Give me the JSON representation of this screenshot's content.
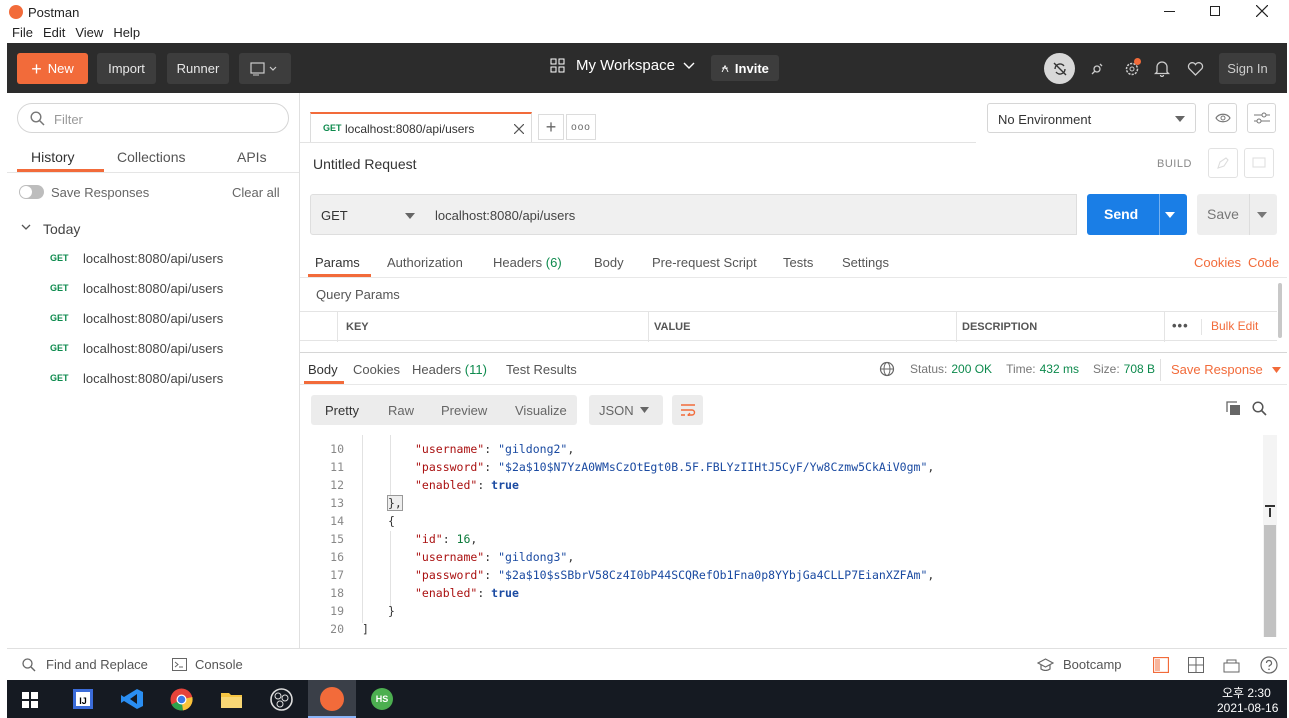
{
  "window": {
    "title": "Postman"
  },
  "menu": [
    "File",
    "Edit",
    "View",
    "Help"
  ],
  "header": {
    "new_label": "New",
    "import_label": "Import",
    "runner_label": "Runner",
    "workspace_label": "My Workspace",
    "invite_label": "Invite",
    "signin_label": "Sign In"
  },
  "sidebar": {
    "filter_placeholder": "Filter",
    "tabs": [
      "History",
      "Collections",
      "APIs"
    ],
    "save_responses_label": "Save Responses",
    "clear_all_label": "Clear all",
    "group_label": "Today",
    "items": [
      {
        "method": "GET",
        "url": "localhost:8080/api/users"
      },
      {
        "method": "GET",
        "url": "localhost:8080/api/users"
      },
      {
        "method": "GET",
        "url": "localhost:8080/api/users"
      },
      {
        "method": "GET",
        "url": "localhost:8080/api/users"
      },
      {
        "method": "GET",
        "url": "localhost:8080/api/users"
      }
    ]
  },
  "request_tab": {
    "method": "GET",
    "url": "localhost:8080/api/users"
  },
  "environment": {
    "selected": "No Environment"
  },
  "request": {
    "title": "Untitled Request",
    "build_label": "BUILD",
    "method": "GET",
    "url": "localhost:8080/api/users",
    "send_label": "Send",
    "save_label": "Save",
    "tabs": {
      "params": "Params",
      "authorization": "Authorization",
      "headers": "Headers",
      "headers_count": "(6)",
      "body": "Body",
      "prerequest": "Pre-request Script",
      "tests": "Tests",
      "settings": "Settings"
    },
    "cookies_label": "Cookies",
    "code_label": "Code",
    "query_params_label": "Query Params",
    "table_headers": {
      "key": "KEY",
      "value": "VALUE",
      "description": "DESCRIPTION"
    },
    "bulk_edit_label": "Bulk Edit"
  },
  "response": {
    "tabs": {
      "body": "Body",
      "cookies": "Cookies",
      "headers": "Headers",
      "headers_count": "(11)",
      "test_results": "Test Results"
    },
    "status_label": "Status:",
    "status_value": "200 OK",
    "time_label": "Time:",
    "time_value": "432 ms",
    "size_label": "Size:",
    "size_value": "708 B",
    "save_response_label": "Save Response",
    "view_modes": [
      "Pretty",
      "Raw",
      "Preview",
      "Visualize"
    ],
    "format": "JSON",
    "lines": [
      {
        "n": "10",
        "key": "\"username\"",
        "val": "\"gildong2\"",
        "type": "s",
        "trail": ","
      },
      {
        "n": "11",
        "key": "\"password\"",
        "val": "\"$2a$10$N7YzA0WMsCzOtEgt0B.5F.FBLYzIIHtJ5CyF/Yw8Czmw5CkAiV0gm\"",
        "type": "s",
        "trail": ","
      },
      {
        "n": "12",
        "key": "\"enabled\"",
        "val": "true",
        "type": "b",
        "trail": ""
      },
      {
        "n": "13",
        "text": "},"
      },
      {
        "n": "14",
        "text": "{"
      },
      {
        "n": "15",
        "key": "\"id\"",
        "val": "16",
        "type": "n",
        "trail": ","
      },
      {
        "n": "16",
        "key": "\"username\"",
        "val": "\"gildong3\"",
        "type": "s",
        "trail": ","
      },
      {
        "n": "17",
        "key": "\"password\"",
        "val": "\"$2a$10$sSBbrV58Cz4I0bP44SCQRefOb1Fna0p8YYbjGa4CLLP7EianXZFAm\"",
        "type": "s",
        "trail": ","
      },
      {
        "n": "18",
        "key": "\"enabled\"",
        "val": "true",
        "type": "b",
        "trail": ""
      },
      {
        "n": "19",
        "text": "}"
      },
      {
        "n": "20",
        "text": "]"
      }
    ]
  },
  "statusbar": {
    "find_replace_label": "Find and Replace",
    "console_label": "Console",
    "bootcamp_label": "Bootcamp"
  },
  "taskbar": {
    "time": "오후 2:30",
    "date": "2021-08-16"
  },
  "colors": {
    "accent": "#f26b3a",
    "send": "#1a7ee6",
    "header_bg": "#2c2c2c",
    "taskbar_bg": "#151a22"
  }
}
